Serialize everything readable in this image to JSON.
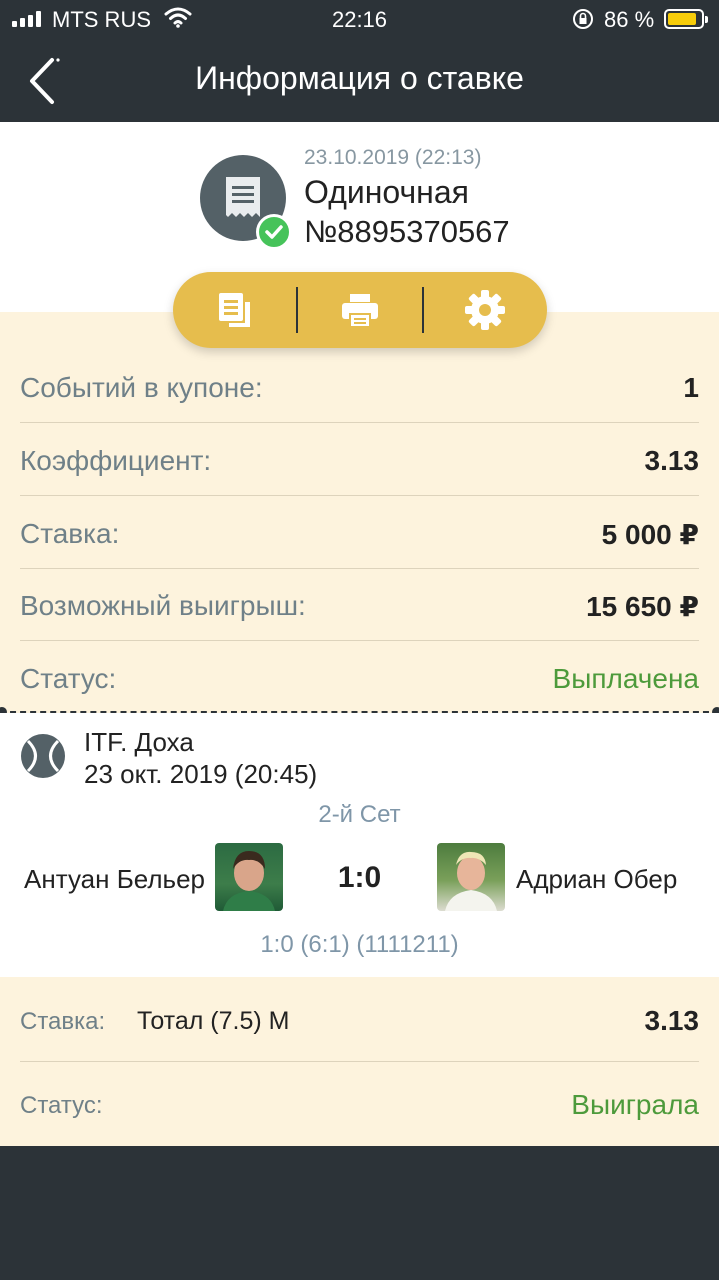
{
  "status_bar": {
    "carrier": "MTS RUS",
    "time": "22:16",
    "battery": "86 %",
    "battery_level": 0.86,
    "battery_color": "#f7cd0a"
  },
  "nav": {
    "title": "Информация о ставке",
    "back_icon": "chevron-left-icon"
  },
  "header": {
    "date": "23.10.2019 (22:13)",
    "type": "Одиночная",
    "number": "№8895370567",
    "icon": "receipt-icon",
    "badge_icon": "check-icon"
  },
  "actions": [
    {
      "icon": "copy-document-icon"
    },
    {
      "icon": "printer-icon"
    },
    {
      "icon": "gear-icon"
    }
  ],
  "summary": {
    "events_label": "Событий в купоне:",
    "events_value": "1",
    "coef_label": "Коэффициент:",
    "coef_value": "3.13",
    "stake_label": "Ставка:",
    "stake_value": "5 000 ₽",
    "win_label": "Возможный выигрыш:",
    "win_value": "15 650 ₽",
    "status_label": "Статус:",
    "status_value": "Выплачена"
  },
  "event": {
    "tournament": "ITF. Доха",
    "date": "23 окт. 2019 (20:45)",
    "set": "2-й Сет",
    "player1": "Антуан Бельер",
    "player2": "Адриан Обер",
    "score": "1:0",
    "score_detail": "1:0 (6:1) (1111211)",
    "sport_icon": "tennis-ball-icon"
  },
  "bet": {
    "stake_label": "Ставка:",
    "outcome": "Тотал (7.5) М",
    "coef": "3.13",
    "status_label": "Статус:",
    "status_value": "Выиграла"
  },
  "colors": {
    "dark": "#2c3338",
    "accent": "#e6bd4d",
    "cream": "#fdf3dd",
    "green": "#4d9a3b"
  }
}
